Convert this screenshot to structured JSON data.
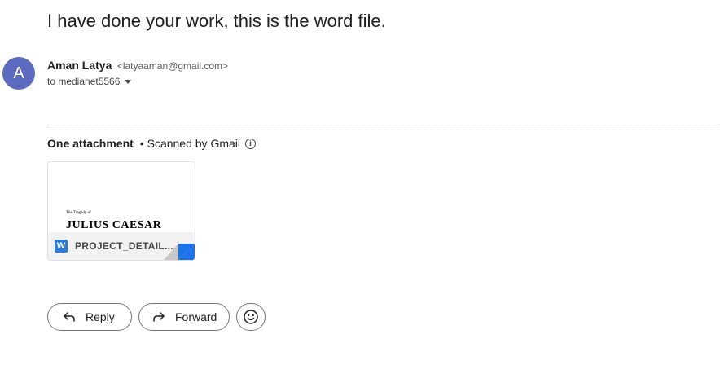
{
  "email": {
    "subject": "I have done your work, this is the word file.",
    "avatar_letter": "A",
    "avatar_color": "#5c6bc0",
    "sender_name": "Aman Latya",
    "sender_email": "<latyaaman@gmail.com>",
    "recipient": "to medianet5566"
  },
  "attachments": {
    "header": "One attachment",
    "scanned": "• Scanned by Gmail",
    "info_icon": "info-icon",
    "items": [
      {
        "preview_small": "The Tragedy of",
        "preview_title": "JULIUS CAESAR",
        "type_icon": "W",
        "file_name": "PROJECT_DETAIL..."
      }
    ]
  },
  "actions": {
    "reply_label": "Reply",
    "forward_label": "Forward",
    "emoji_icon": "smiley-icon"
  },
  "colors": {
    "accent": "#1a73e8",
    "word_blue": "#2b7cd3"
  }
}
